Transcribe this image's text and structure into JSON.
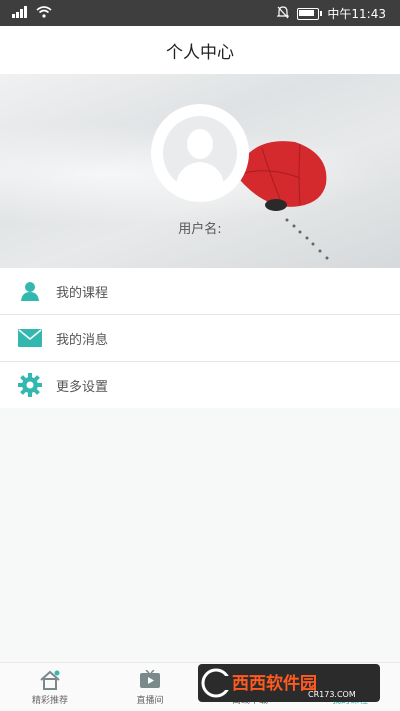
{
  "status_bar": {
    "time": "中午11:43"
  },
  "header": {
    "title": "个人中心"
  },
  "profile": {
    "username_label": "用户名:"
  },
  "menu": {
    "items": [
      {
        "label": "我的课程",
        "icon": "user-icon"
      },
      {
        "label": "我的消息",
        "icon": "mail-icon"
      },
      {
        "label": "更多设置",
        "icon": "gear-icon"
      }
    ]
  },
  "tabbar": {
    "tabs": [
      {
        "label": "精彩推荐",
        "icon": "house-icon"
      },
      {
        "label": "直播间",
        "icon": "tv-play-icon"
      },
      {
        "label": "离线下载",
        "icon": "download-icon"
      },
      {
        "label": "我的课程",
        "icon": "person-icon"
      }
    ]
  },
  "watermark": {
    "text": "西西软件园",
    "subtext": "CR173.COM"
  },
  "colors": {
    "accent": "#33b8b0",
    "status_bar": "#3e3e3e",
    "umbrella": "#d42a2e"
  }
}
